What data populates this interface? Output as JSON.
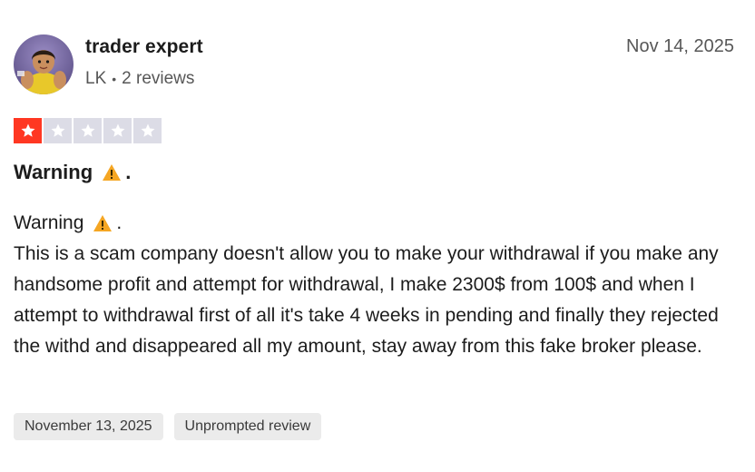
{
  "reviewer": {
    "name": "trader expert",
    "country": "LK",
    "separator": "•",
    "review_count": "2 reviews"
  },
  "review": {
    "date": "Nov 14, 2025",
    "rating": 1,
    "max_rating": 5,
    "title": "Warning",
    "title_suffix": ".",
    "body_heading": "Warning",
    "body_heading_suffix": ".",
    "body_text": "This is a scam company doesn't allow you to make your withdrawal if you make any handsome profit and attempt for withdrawal, I make 2300$ from 100$ and when I attempt to withdrawal first of all it's take 4 weeks in pending and finally they rejected the withd and disappeared all my amount, stay away from this fake broker please."
  },
  "tags": {
    "experience_date": "November 13, 2025",
    "review_type": "Unprompted review"
  },
  "colors": {
    "star_filled": "#ff3722",
    "star_empty": "#dcdce6",
    "warning": "#f5a623"
  },
  "icons": {
    "avatar": "reviewer-avatar-photo",
    "star": "star-icon",
    "warning": "warning-icon"
  }
}
